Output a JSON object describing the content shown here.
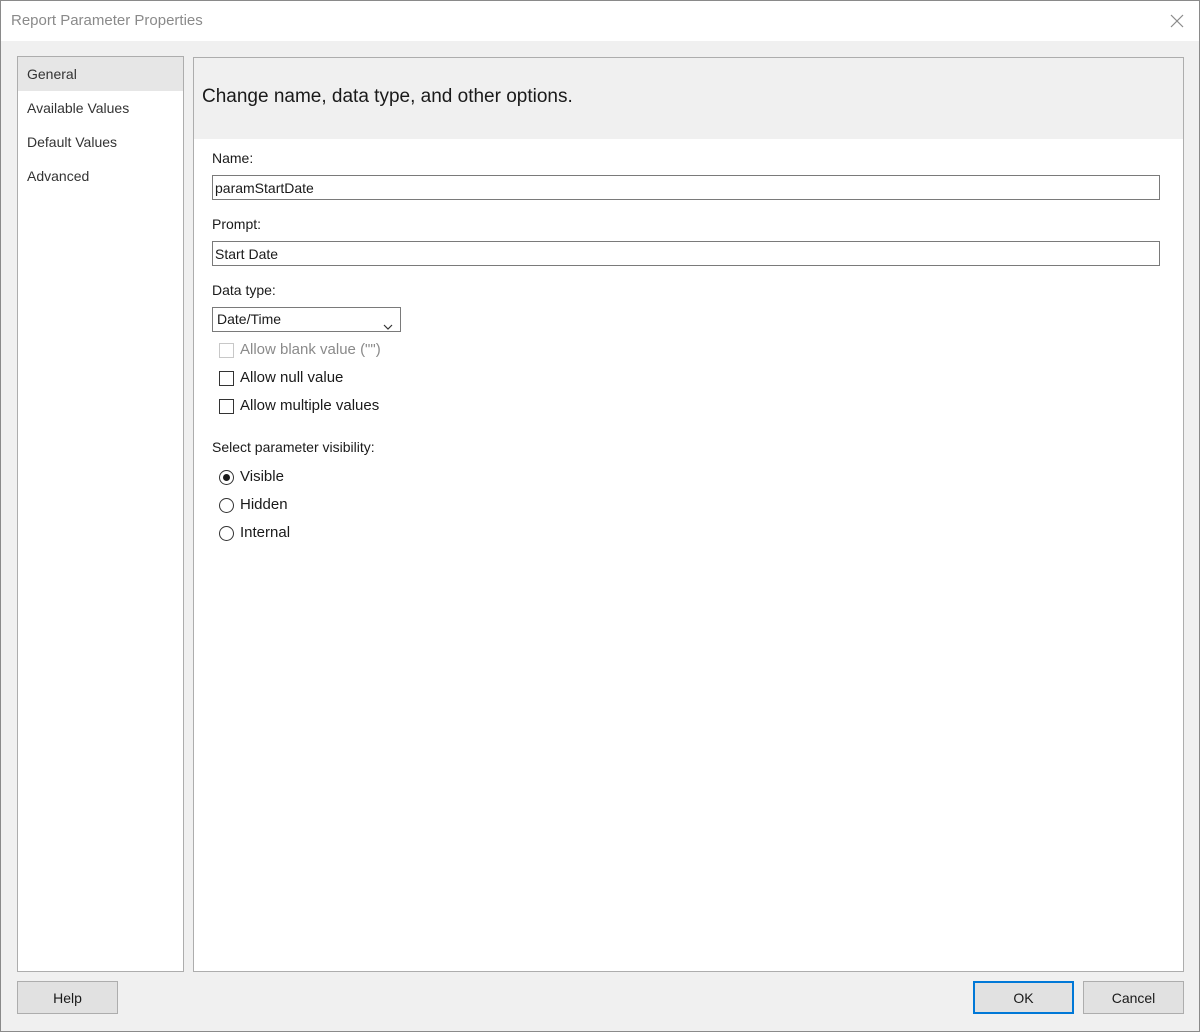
{
  "window": {
    "title": "Report Parameter Properties",
    "close_icon": "close-icon"
  },
  "nav": {
    "items": [
      {
        "label": "General",
        "selected": true
      },
      {
        "label": "Available Values",
        "selected": false
      },
      {
        "label": "Default Values",
        "selected": false
      },
      {
        "label": "Advanced",
        "selected": false
      }
    ]
  },
  "main": {
    "header": "Change name, data type, and other options.",
    "name": {
      "label": "Name:",
      "value": "paramStartDate"
    },
    "prompt": {
      "label": "Prompt:",
      "value": "Start Date"
    },
    "data_type": {
      "label": "Data type:",
      "selected": "Date/Time",
      "icon": "chevron-down-icon"
    },
    "options": [
      {
        "label": "Allow blank value (\"\")",
        "checked": false,
        "enabled": false
      },
      {
        "label": "Allow null value",
        "checked": false,
        "enabled": true
      },
      {
        "label": "Allow multiple values",
        "checked": false,
        "enabled": true
      }
    ],
    "visibility": {
      "label": "Select parameter visibility:",
      "options": [
        {
          "label": "Visible",
          "selected": true
        },
        {
          "label": "Hidden",
          "selected": false
        },
        {
          "label": "Internal",
          "selected": false
        }
      ]
    }
  },
  "buttons": {
    "help": "Help",
    "ok": "OK",
    "cancel": "Cancel"
  },
  "colors": {
    "accent": "#0078d7",
    "dialog_background": "#f0f0f0",
    "selected_nav": "#e6e6e6"
  }
}
